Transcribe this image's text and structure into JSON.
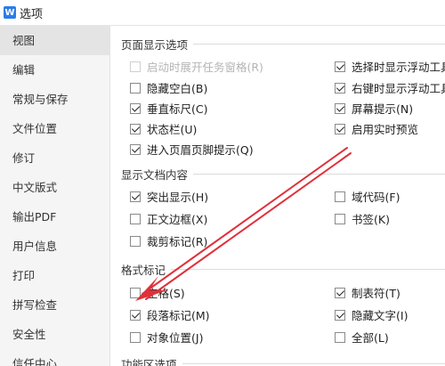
{
  "window": {
    "title": "选项",
    "icon": "wps-app-icon"
  },
  "sidebar": {
    "items": [
      {
        "label": "视图",
        "active": true
      },
      {
        "label": "编辑"
      },
      {
        "label": "常规与保存"
      },
      {
        "label": "文件位置"
      },
      {
        "label": "修订"
      },
      {
        "label": "中文版式"
      },
      {
        "label": "输出PDF"
      },
      {
        "label": "用户信息"
      },
      {
        "label": "打印"
      },
      {
        "label": "拼写检查"
      },
      {
        "label": "安全性"
      },
      {
        "label": "信任中心"
      }
    ]
  },
  "sections": {
    "page_display": {
      "title": "页面显示选项",
      "options": [
        {
          "label": "启动时展开任务窗格(R)",
          "checked": false,
          "disabled": true
        },
        {
          "label": "选择时显示浮动工具",
          "checked": true
        },
        {
          "label": "隐藏空白(B)",
          "checked": false
        },
        {
          "label": "右键时显示浮动工具",
          "checked": true
        },
        {
          "label": "垂直标尺(C)",
          "checked": true
        },
        {
          "label": "屏幕提示(N)",
          "checked": true
        },
        {
          "label": "状态栏(U)",
          "checked": true
        },
        {
          "label": "启用实时预览",
          "checked": true
        },
        {
          "label": "进入页眉页脚提示(Q)",
          "checked": true
        }
      ]
    },
    "doc_content": {
      "title": "显示文档内容",
      "options": [
        {
          "label": "突出显示(H)",
          "checked": true
        },
        {
          "label": "域代码(F)",
          "checked": false
        },
        {
          "label": "正文边框(X)",
          "checked": false
        },
        {
          "label": "书签(K)",
          "checked": false
        },
        {
          "label": "裁剪标记(R)",
          "checked": false
        }
      ]
    },
    "format_marks": {
      "title": "格式标记",
      "options": [
        {
          "label": "空格(S)",
          "checked": false
        },
        {
          "label": "制表符(T)",
          "checked": true
        },
        {
          "label": "段落标记(M)",
          "checked": true
        },
        {
          "label": "隐藏文字(I)",
          "checked": true
        },
        {
          "label": "对象位置(J)",
          "checked": false
        },
        {
          "label": "全部(L)",
          "checked": false
        }
      ]
    },
    "ribbon": {
      "title": "功能区选项"
    }
  },
  "annotation": {
    "color": "#e0303a"
  }
}
